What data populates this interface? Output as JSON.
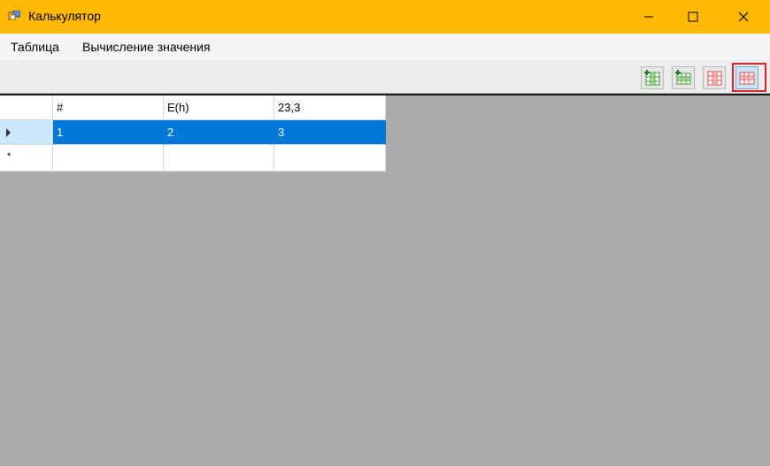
{
  "window": {
    "title": "Калькулятор",
    "accent_color": "#ffb900",
    "icon": "app-window-icon"
  },
  "menu": {
    "items": [
      {
        "label": "Таблица"
      },
      {
        "label": "Вычисление значения"
      }
    ]
  },
  "toolbar": {
    "buttons": [
      {
        "icon": "add-column-icon"
      },
      {
        "icon": "add-row-icon"
      },
      {
        "icon": "delete-column-icon"
      },
      {
        "icon": "delete-row-icon"
      }
    ]
  },
  "grid": {
    "columns": [
      "#",
      "E(h)",
      "23,3"
    ],
    "rows": [
      {
        "values": [
          "1",
          "2",
          "3"
        ],
        "selected": true,
        "marker": "current-row-arrow-icon"
      },
      {
        "values": [
          "",
          "",
          ""
        ],
        "selected": false,
        "marker": "*"
      }
    ],
    "selection_color": "#0078d7"
  }
}
